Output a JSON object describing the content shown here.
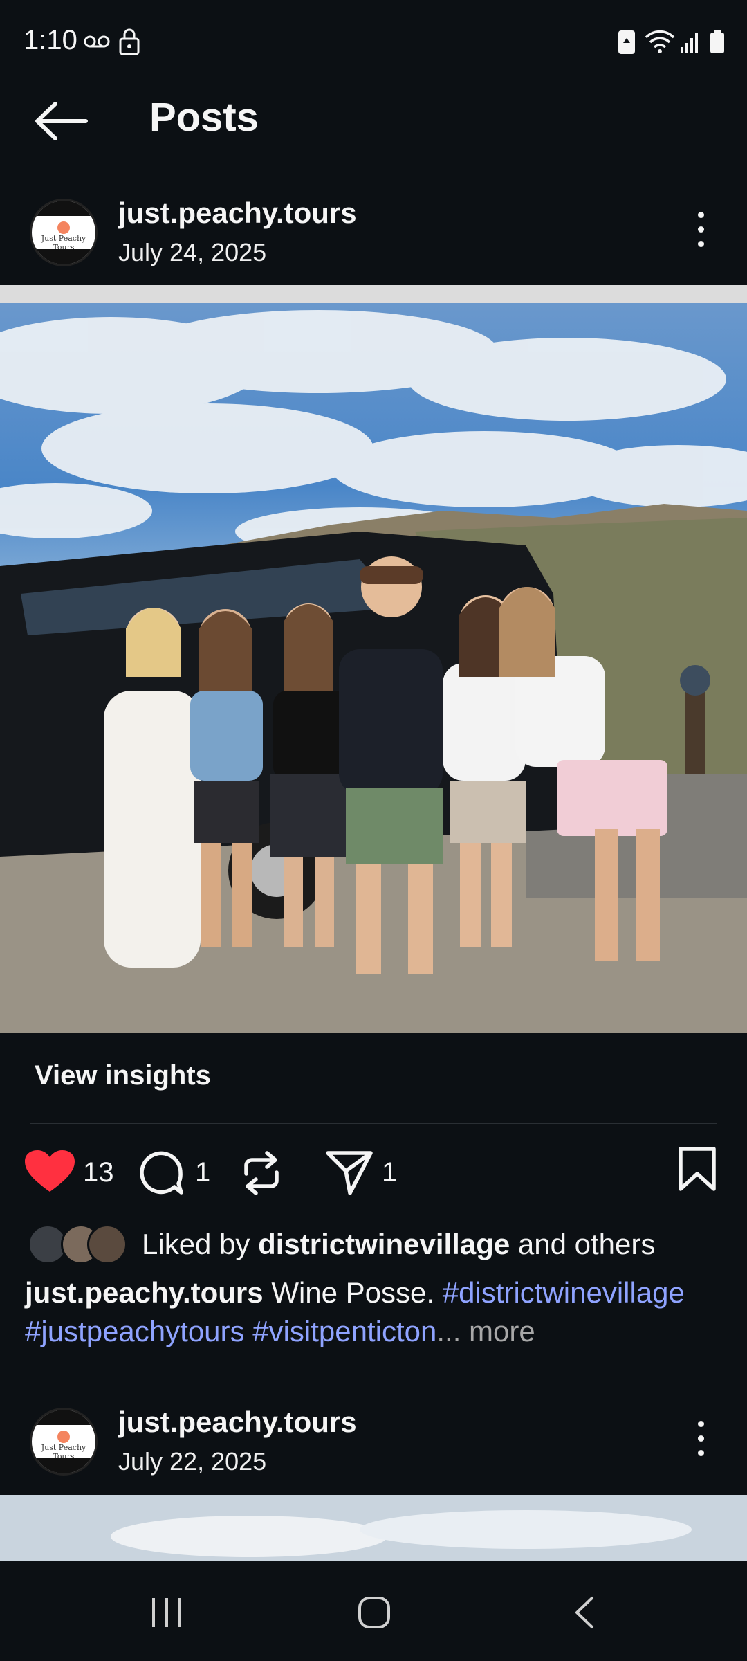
{
  "status_bar": {
    "time": "1:10"
  },
  "header": {
    "title": "Posts"
  },
  "posts": [
    {
      "username": "just.peachy.tours",
      "avatar_label": "Just Peachy Tours",
      "date": "July 24, 2025",
      "view_insights": "View insights",
      "likes_count": "13",
      "comments_count": "1",
      "shares_count": "1",
      "liked_by_prefix": "Liked by",
      "liked_by_user": "districtwinevillage",
      "liked_by_suffix": "and others",
      "caption_user": "just.peachy.tours",
      "caption_text": "Wine Posse.",
      "hashtags": [
        "#districtwinevillage",
        "#justpeachytours",
        "#visitpenticton"
      ],
      "ellipsis": "...",
      "more": "more"
    },
    {
      "username": "just.peachy.tours",
      "avatar_label": "Just Peachy Tours",
      "date": "July 22, 2025"
    }
  ],
  "colors": {
    "background": "#0c1014",
    "like_red": "#ff3040",
    "hashtag": "#8fa3ff"
  }
}
